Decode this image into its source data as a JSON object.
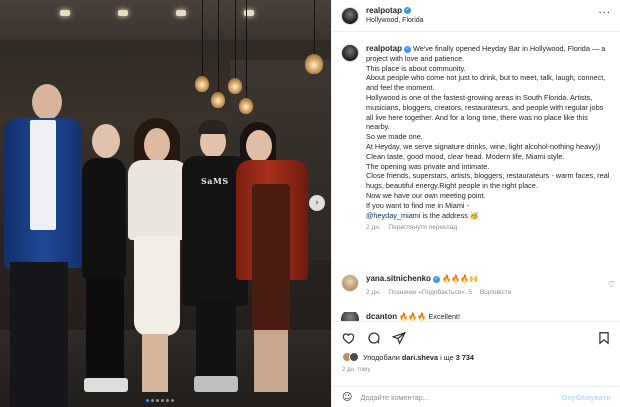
{
  "post": {
    "username": "realpotap",
    "location": "Hollywood, Florida"
  },
  "caption": {
    "username": "realpotap",
    "lines": [
      "We've finally opened Heyday Bar in Hollywood, Florida — a project with love and patience.",
      "This place is about community.",
      "About people who come not just to drink, but to meet, talk, laugh, connect, and feel the moment.",
      "Hollywood is one of the fastest-growing areas in South Florida. Artists, musicians, bloggers, creators, restaurateurs, and people with regular jobs all live here together. And for a long time, there was no place like this nearby.",
      "So we made one.",
      "At Heyday, we serve signature drinks, wine, light alcohol-nothing heavy))",
      "Clean taste, good mood, clear head. Modern life, Miami style.",
      "The opening was private and intimate.",
      "Close friends, superstars, artists, bloggers, restaurateurs - warm faces, real hugs, beautiful energy.Right people in the right place.",
      "Now we have our own meeting point.",
      "If you want to find me in Miami -"
    ],
    "mention": "@heyday_miami",
    "tail": " is the address 🥳",
    "time": "2 дн.",
    "translate": "Переглянути переклад"
  },
  "comments": [
    {
      "username": "yana.sitnichenko",
      "text": "🔥🔥🔥🙌",
      "time": "2 дн.",
      "likes": "Позначки «Подобається»: 5",
      "reply": "Відповісти"
    },
    {
      "username": "dcanton",
      "text": "🔥🔥🔥 Excellent!"
    }
  ],
  "likes": {
    "prefix": "Уподобали",
    "user": "dari.sheva",
    "mid": "і ще",
    "count": "3 734",
    "time": "2 дн. тому"
  },
  "composer": {
    "placeholder": "Додайте коментар...",
    "post_label": "Опублікувати",
    "emoji": "☺"
  },
  "photo": {
    "shirt_text": "SaMS",
    "carousel_dots": 6,
    "active_dot": 0
  },
  "icons": {
    "heart": "heart-icon",
    "comment": "comment-icon",
    "share": "share-icon",
    "save": "bookmark-icon",
    "more": "more-icon",
    "verified": "verified-badge-icon"
  },
  "colors": {
    "verified": "#3897f0",
    "link": "#00376b",
    "muted": "#8e8e8e",
    "post_button": "#b3dbff"
  }
}
